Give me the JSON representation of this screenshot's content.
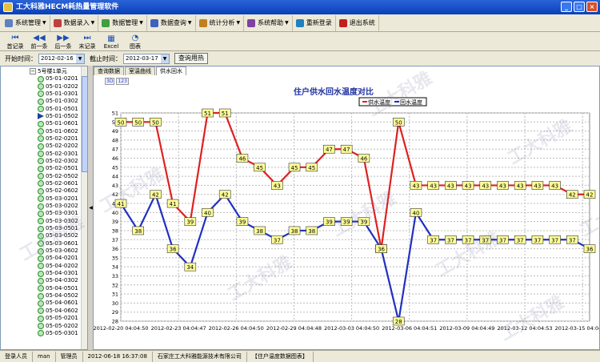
{
  "window": {
    "title": "工大科雅HECM耗热量管理软件",
    "min": "_",
    "max": "□",
    "close": "×"
  },
  "menu": [
    {
      "label": "系统管理",
      "color": "#6080c0",
      "has_arrow": true
    },
    {
      "label": "数据录入",
      "color": "#c04040",
      "has_arrow": true
    },
    {
      "label": "数据管理",
      "color": "#40a040",
      "has_arrow": true
    },
    {
      "label": "数据查询",
      "color": "#4060c0",
      "has_arrow": true
    },
    {
      "label": "统计分析",
      "color": "#c08020",
      "has_arrow": true
    },
    {
      "label": "系统帮助",
      "color": "#8040a0",
      "has_arrow": true
    },
    {
      "label": "重新登录",
      "color": "#2080c0",
      "has_arrow": false
    },
    {
      "label": "退出系统",
      "color": "#c02020",
      "has_arrow": false
    }
  ],
  "toolbar": [
    {
      "label": "首记录",
      "icon": "⏮",
      "name": "first-record"
    },
    {
      "label": "前一条",
      "icon": "◀◀",
      "name": "prev-record"
    },
    {
      "label": "后一条",
      "icon": "▶▶",
      "name": "next-record"
    },
    {
      "label": "末记录",
      "icon": "⏭",
      "name": "last-record"
    },
    {
      "label": "Excel",
      "icon": "▦",
      "name": "excel"
    },
    {
      "label": "图表",
      "icon": "◔",
      "name": "chart"
    }
  ],
  "filter": {
    "start_label": "开始时间：",
    "start_value": "2012-02-16",
    "end_label": "截止时间：",
    "end_value": "2012-03-17",
    "query_button": "查询用热"
  },
  "tree": {
    "root": "5号楼1单元",
    "items": [
      "05-01-0201",
      "05-01-0202",
      "05-01-0301",
      "05-01-0302",
      "05-01-0501",
      "05-01-0502",
      "05-01-0601",
      "05-01-0602",
      "05-02-0201",
      "05-02-0202",
      "05-02-0301",
      "05-02-0302",
      "05-02-0501",
      "05-02-0502",
      "05-02-0601",
      "05-02-0602",
      "05-03-0201",
      "05-03-0202",
      "05-03-0301",
      "05-03-0302",
      "05-03-0501",
      "05-03-0502",
      "05-03-0601",
      "05-03-0602",
      "05-04-0201",
      "05-04-0202",
      "05-04-0301",
      "05-04-0302",
      "05-04-0501",
      "05-04-0502",
      "05-04-0601",
      "05-04-0602",
      "05-05-0201",
      "05-05-0202",
      "05-05-0301"
    ],
    "selected_index": 5
  },
  "tabs": [
    "查询数据",
    "室温曲线",
    "供水回水"
  ],
  "active_tab": 2,
  "zoom": [
    "3D",
    "123"
  ],
  "chart_data": {
    "type": "line",
    "title": "住户供水回水温度对比",
    "ylim": [
      28,
      51
    ],
    "yticks": [
      28,
      29,
      30,
      31,
      32,
      33,
      34,
      35,
      36,
      37,
      38,
      39,
      40,
      41,
      42,
      43,
      44,
      45,
      46,
      47,
      48,
      49,
      50,
      51
    ],
    "xtick_labels": [
      "2012-02-20 04:04:50",
      "2012-02-23 04:04:47",
      "2012-02-26 04:04:50",
      "2012-02-29 04:04:48",
      "2012-03-03 04:04:50",
      "2012-03-06 04:04:51",
      "2012-03-09 04:04:49",
      "2012-03-12 04:04:53",
      "2012-03-15 04:04:50"
    ],
    "x": [
      0,
      1,
      2,
      3,
      4,
      5,
      6,
      7,
      8,
      9,
      10,
      11,
      12,
      13,
      14,
      15,
      16,
      17,
      18,
      19,
      20,
      21,
      22,
      23,
      24,
      25,
      26,
      27
    ],
    "grid": true,
    "legend_position": "top",
    "series": [
      {
        "name": "供水温度",
        "color": "#e02020",
        "values": [
          50,
          50,
          50,
          41,
          39,
          51,
          51,
          46,
          45,
          43,
          45,
          45,
          47,
          47,
          46,
          36,
          50,
          43,
          43,
          43,
          43,
          43,
          43,
          43,
          43,
          43,
          42,
          42
        ]
      },
      {
        "name": "回水温度",
        "color": "#2030c0",
        "values": [
          41,
          38,
          42,
          36,
          34,
          40,
          42,
          39,
          38,
          37,
          38,
          38,
          39,
          39,
          39,
          36,
          28,
          40,
          37,
          37,
          37,
          37,
          37,
          37,
          37,
          37,
          37,
          36
        ]
      }
    ]
  },
  "status": [
    "登录人员",
    "man",
    "管理员",
    "2012-06-18 16:37:08",
    "石家庄工大科雅能源技术有限公司",
    "【住户温度数据图表】"
  ],
  "watermark": "工大科雅"
}
